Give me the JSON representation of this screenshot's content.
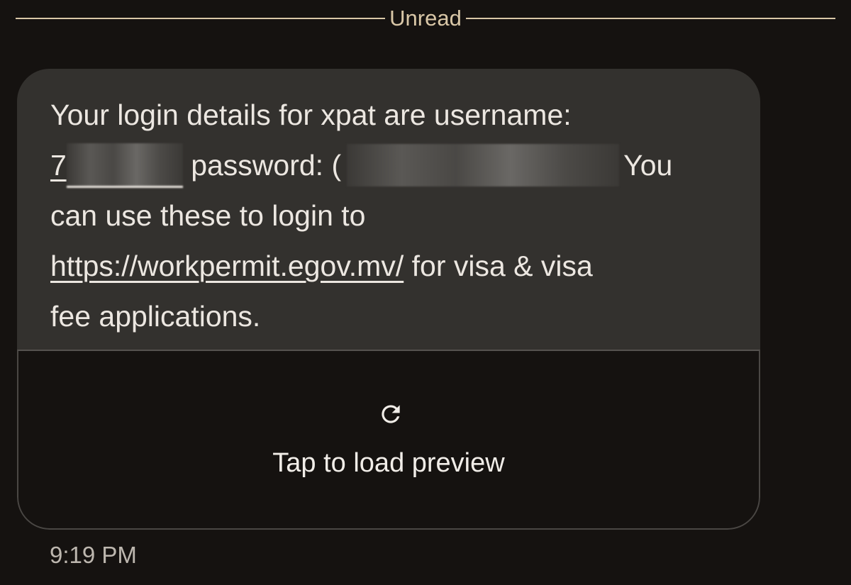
{
  "divider": {
    "label": "Unread"
  },
  "message": {
    "line1": "Your login details for xpat are username:",
    "username_visible": "7",
    "password_label": " password: ",
    "password_visible": "(",
    "line2_tail": "You",
    "line3": "can use these to login to",
    "link": "https://workpermit.egov.mv/",
    "line4_tail": " for visa & visa",
    "line5": "fee applications."
  },
  "preview": {
    "icon": "reload-icon",
    "label": "Tap to load preview"
  },
  "timestamp": "9:19 PM",
  "colors": {
    "background": "#151210",
    "bubble": "#33312e",
    "divider": "#d9c7a7",
    "text": "#ece7e1"
  }
}
